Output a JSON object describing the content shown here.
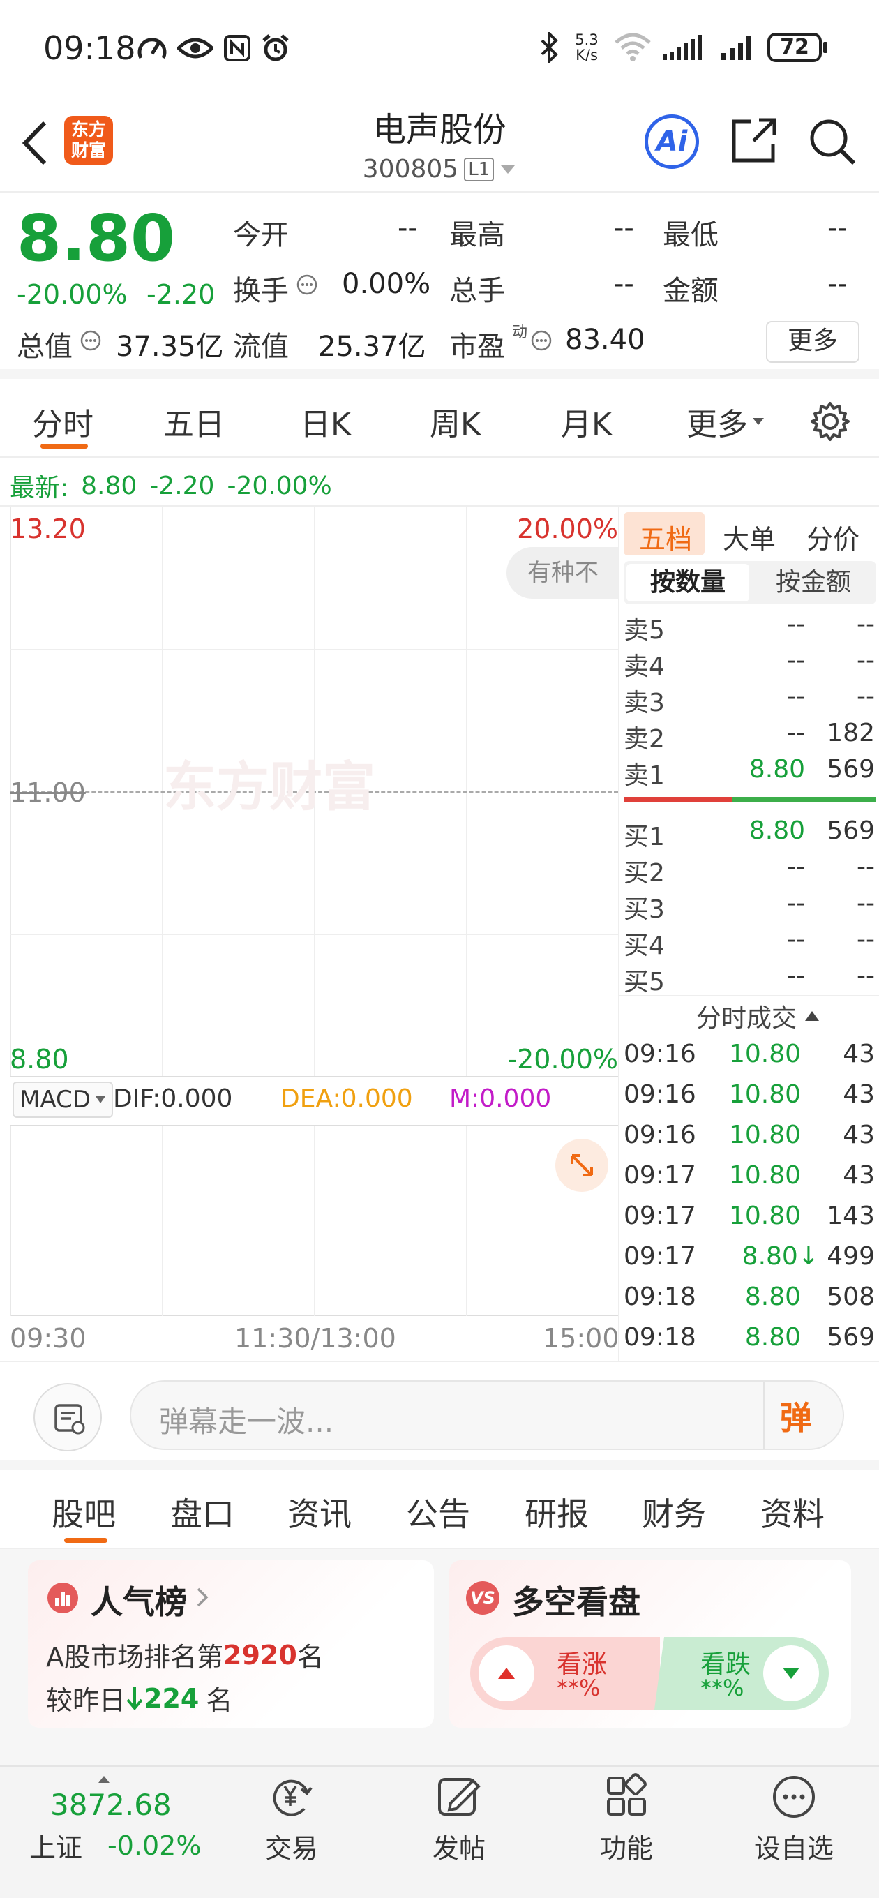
{
  "status_bar": {
    "time": "09:18",
    "net_speed_top": "5.3",
    "net_speed_bottom": "K/s",
    "battery": "72"
  },
  "header": {
    "logo_line1": "东方",
    "logo_line2": "财富",
    "stock_name": "电声股份",
    "stock_code": "300805",
    "level_badge": "L1"
  },
  "quote": {
    "price": "8.80",
    "change_pct": "-20.00%",
    "change_amt": "-2.20",
    "open_label": "今开",
    "open_value": "--",
    "high_label": "最高",
    "high_value": "--",
    "low_label": "最低",
    "low_value": "--",
    "turnover_label": "换手",
    "turnover_value": "0.00%",
    "volume_label": "总手",
    "volume_value": "--",
    "amount_label": "金额",
    "amount_value": "--",
    "mktcap_label": "总值",
    "mktcap_value": "37.35亿",
    "float_label": "流值",
    "float_value": "25.37亿",
    "pe_label": "市盈",
    "pe_sup": "动",
    "pe_value": "83.40",
    "more_button": "更多"
  },
  "chart_tabs": [
    "分时",
    "五日",
    "日K",
    "周K",
    "月K",
    "更多"
  ],
  "latest": {
    "label": "最新:",
    "price": "8.80",
    "change": "-2.20",
    "pct": "-20.00%"
  },
  "intraday": {
    "y_max": "13.20",
    "y_mid": "11.00",
    "y_min": "8.80",
    "pct_max": "20.00%",
    "pct_min": "-20.00%",
    "watermark": "东方财富",
    "float_tip": "有种不",
    "x_start": "09:30",
    "x_mid": "11:30/13:00",
    "x_end": "15:00"
  },
  "macd": {
    "select_label": "MACD",
    "dif": "DIF:0.000",
    "dea": "DEA:0.000",
    "m": "M:0.000"
  },
  "side_tabs": [
    "五档",
    "大单",
    "分价"
  ],
  "side_subtabs": [
    "按数量",
    "按金额"
  ],
  "order_book": {
    "asks": [
      {
        "label": "卖5",
        "price": "--",
        "vol": "--"
      },
      {
        "label": "卖4",
        "price": "--",
        "vol": "--"
      },
      {
        "label": "卖3",
        "price": "--",
        "vol": "--"
      },
      {
        "label": "卖2",
        "price": "--",
        "vol": "182"
      },
      {
        "label": "卖1",
        "price": "8.80",
        "vol": "569"
      }
    ],
    "bids": [
      {
        "label": "买1",
        "price": "8.80",
        "vol": "569"
      },
      {
        "label": "买2",
        "price": "--",
        "vol": "--"
      },
      {
        "label": "买3",
        "price": "--",
        "vol": "--"
      },
      {
        "label": "买4",
        "price": "--",
        "vol": "--"
      },
      {
        "label": "买5",
        "price": "--",
        "vol": "--"
      }
    ]
  },
  "trades": {
    "title": "分时成交",
    "rows": [
      {
        "time": "09:16",
        "price": "10.80",
        "vol": "43"
      },
      {
        "time": "09:16",
        "price": "10.80",
        "vol": "43"
      },
      {
        "time": "09:16",
        "price": "10.80",
        "vol": "43"
      },
      {
        "time": "09:17",
        "price": "10.80",
        "vol": "43"
      },
      {
        "time": "09:17",
        "price": "10.80",
        "vol": "143"
      },
      {
        "time": "09:17",
        "price": "8.80↓",
        "vol": "499"
      },
      {
        "time": "09:18",
        "price": "8.80",
        "vol": "508"
      },
      {
        "time": "09:18",
        "price": "8.80",
        "vol": "569"
      }
    ]
  },
  "danmaku": {
    "placeholder": "弹幕走一波...",
    "send_label": "弹"
  },
  "bottom_tabs": [
    "股吧",
    "盘口",
    "资讯",
    "公告",
    "研报",
    "财务",
    "资料"
  ],
  "popularity": {
    "title": "人气榜",
    "rank_prefix": "A股市场排名第",
    "rank": "2920",
    "rank_suffix": "名",
    "change_prefix": "较昨日",
    "change": "224",
    "change_suffix": "名"
  },
  "bull_bear": {
    "title": "多空看盘",
    "up_label": "看涨",
    "up_pct": "**%",
    "down_label": "看跌",
    "down_pct": "**%"
  },
  "bottom_nav": {
    "index_value": "3872.68",
    "index_name": "上证",
    "index_change": "-0.02%",
    "items": [
      "交易",
      "发帖",
      "功能",
      "设自选"
    ]
  },
  "colors": {
    "down_green": "#17a03a",
    "up_red": "#d8332e",
    "accent_orange": "#f06a14",
    "ai_blue": "#2f63e8"
  }
}
